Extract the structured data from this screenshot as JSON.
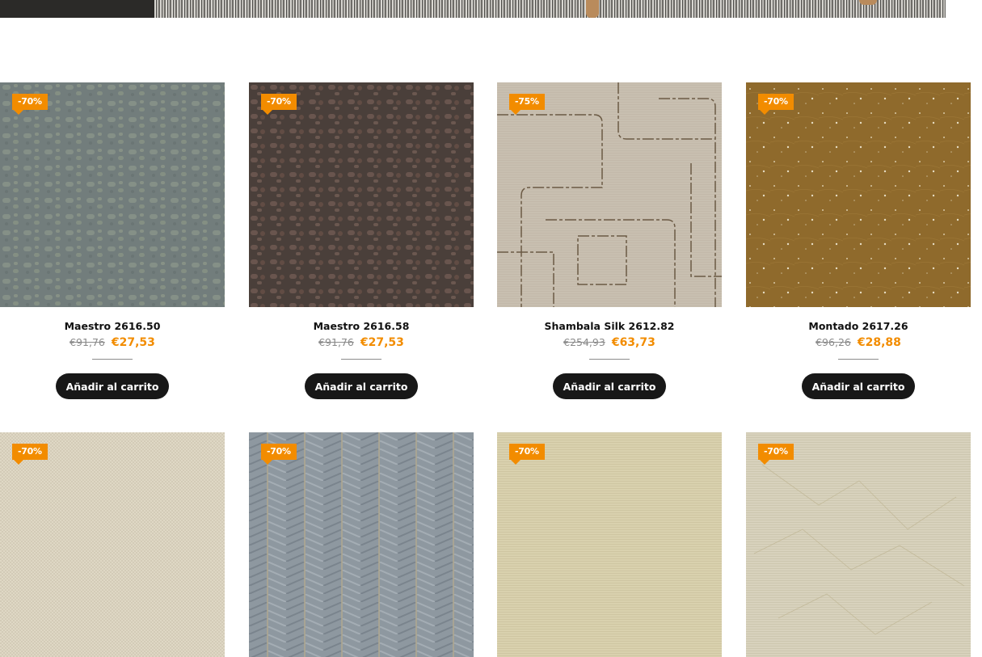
{
  "products": [
    {
      "badge": "-70%",
      "name": "Maestro 2616.50",
      "old_price": "€91,76",
      "new_price": "€27,53",
      "cta": "Añadir al carrito",
      "swatch": "#727d7c"
    },
    {
      "badge": "-70%",
      "name": "Maestro 2616.58",
      "old_price": "€91,76",
      "new_price": "€27,53",
      "cta": "Añadir al carrito",
      "swatch": "#4a3f3a"
    },
    {
      "badge": "-75%",
      "name": "Shambala Silk 2612.82",
      "old_price": "€254,93",
      "new_price": "€63,73",
      "cta": "Añadir al carrito",
      "swatch": "#c8bfb0"
    },
    {
      "badge": "-70%",
      "name": "Montado 2617.26",
      "old_price": "€96,26",
      "new_price": "€28,88",
      "cta": "Añadir al carrito",
      "swatch": "#8f6a2c"
    },
    {
      "badge": "-70%",
      "swatch": "#dfd8c5"
    },
    {
      "badge": "-70%",
      "swatch": "#8e98a0"
    },
    {
      "badge": "-70%",
      "swatch": "#d9d1ae"
    },
    {
      "badge": "-70%",
      "swatch": "#d8d2bd"
    }
  ],
  "colors": {
    "accent": "#f28c00",
    "button": "#181818"
  }
}
